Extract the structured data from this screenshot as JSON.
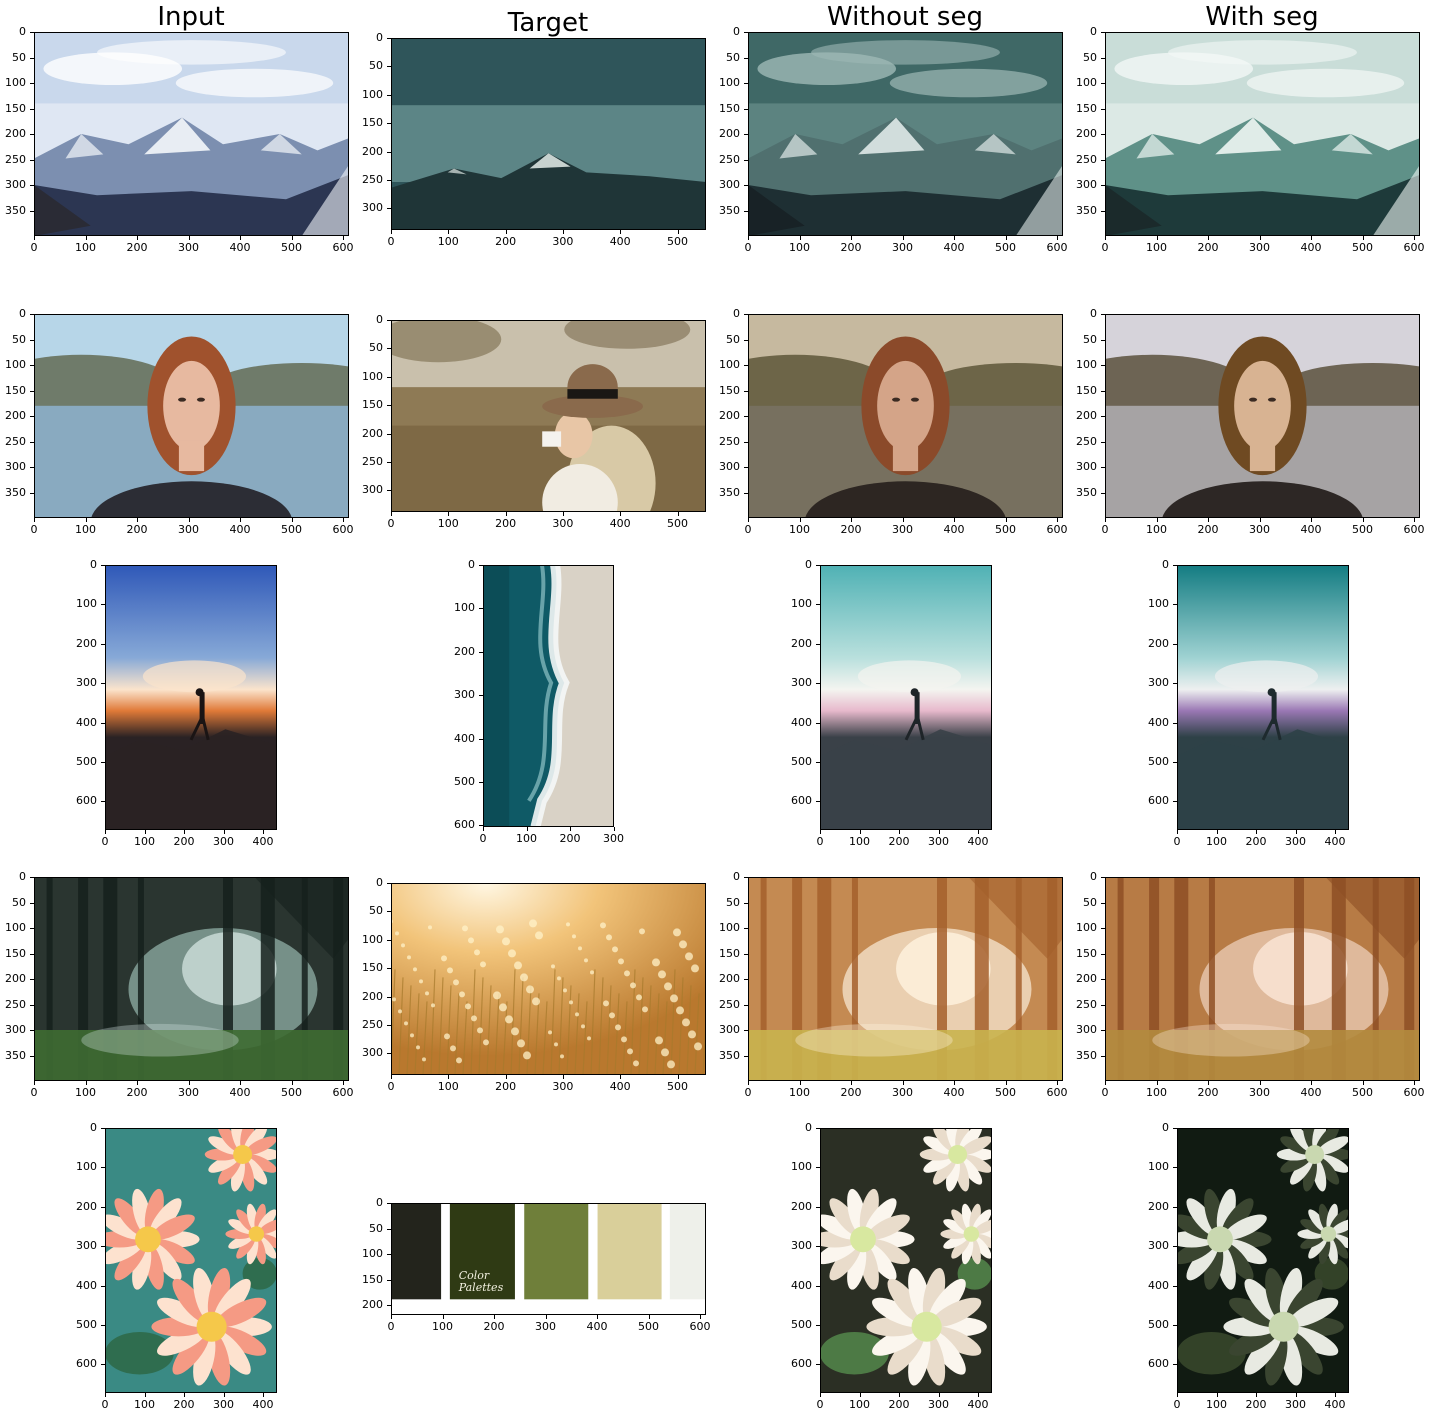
{
  "columns": [
    {
      "key": "input",
      "title": "Input"
    },
    {
      "key": "target",
      "title": "Target"
    },
    {
      "key": "without_seg",
      "title": "Without seg"
    },
    {
      "key": "with_seg",
      "title": "With seg"
    }
  ],
  "rows": [
    {
      "scene": "mountains",
      "panels": {
        "input": {
          "subject": "snowy mountain range under cloudy blue sky",
          "y_ticks": [
            "0",
            "50",
            "100",
            "150",
            "200",
            "250",
            "300",
            "350"
          ],
          "x_ticks": [
            "0",
            "100",
            "200",
            "300",
            "400",
            "500",
            "600"
          ]
        },
        "target": {
          "subject": "teal dusk sky over dark mountain silhouette",
          "y_ticks": [
            "0",
            "50",
            "100",
            "150",
            "200",
            "250",
            "300"
          ],
          "x_ticks": [
            "0",
            "100",
            "200",
            "300",
            "400",
            "500"
          ]
        },
        "without_seg": {
          "subject": "mountain range recolored dark teal",
          "y_ticks": [
            "0",
            "50",
            "100",
            "150",
            "200",
            "250",
            "300",
            "350"
          ],
          "x_ticks": [
            "0",
            "100",
            "200",
            "300",
            "400",
            "500",
            "600"
          ]
        },
        "with_seg": {
          "subject": "mountain range recolored light teal",
          "y_ticks": [
            "0",
            "50",
            "100",
            "150",
            "200",
            "250",
            "300",
            "350"
          ],
          "x_ticks": [
            "0",
            "100",
            "200",
            "300",
            "400",
            "500",
            "600"
          ]
        }
      }
    },
    {
      "scene": "portrait",
      "panels": {
        "input": {
          "subject": "red-haired woman portrait by a lake",
          "y_ticks": [
            "0",
            "50",
            "100",
            "150",
            "200",
            "250",
            "300",
            "350"
          ],
          "x_ticks": [
            "0",
            "100",
            "200",
            "300",
            "400",
            "500",
            "600"
          ]
        },
        "target": {
          "subject": "woman in hat drinking from cup in autumn field",
          "y_ticks": [
            "0",
            "50",
            "100",
            "150",
            "200",
            "250",
            "300"
          ],
          "x_ticks": [
            "0",
            "100",
            "200",
            "300",
            "400",
            "500"
          ]
        },
        "without_seg": {
          "subject": "portrait recolored warm brown",
          "y_ticks": [
            "0",
            "50",
            "100",
            "150",
            "200",
            "250",
            "300",
            "350"
          ],
          "x_ticks": [
            "0",
            "100",
            "200",
            "300",
            "400",
            "500",
            "600"
          ]
        },
        "with_seg": {
          "subject": "portrait recolored muted grey-brown",
          "y_ticks": [
            "0",
            "50",
            "100",
            "150",
            "200",
            "250",
            "300",
            "350"
          ],
          "x_ticks": [
            "0",
            "100",
            "200",
            "300",
            "400",
            "500",
            "600"
          ]
        }
      }
    },
    {
      "scene": "sunset silhouette",
      "panels": {
        "input": {
          "subject": "person silhouette walking at sunset",
          "y_ticks": [
            "0",
            "100",
            "200",
            "300",
            "400",
            "500",
            "600"
          ],
          "x_ticks": [
            "0",
            "100",
            "200",
            "300",
            "400"
          ]
        },
        "target": {
          "subject": "aerial view of teal ocean waves on sand",
          "y_ticks": [
            "0",
            "100",
            "200",
            "300",
            "400",
            "500",
            "600"
          ],
          "x_ticks": [
            "0",
            "100",
            "200",
            "300"
          ]
        },
        "without_seg": {
          "subject": "silhouette recolored teal and pink",
          "y_ticks": [
            "0",
            "100",
            "200",
            "300",
            "400",
            "500",
            "600"
          ],
          "x_ticks": [
            "0",
            "100",
            "200",
            "300",
            "400"
          ]
        },
        "with_seg": {
          "subject": "silhouette recolored deep teal and violet",
          "y_ticks": [
            "0",
            "100",
            "200",
            "300",
            "400",
            "500",
            "600"
          ],
          "x_ticks": [
            "0",
            "100",
            "200",
            "300",
            "400"
          ]
        }
      }
    },
    {
      "scene": "forest",
      "panels": {
        "input": {
          "subject": "dark misty green forest",
          "y_ticks": [
            "0",
            "50",
            "100",
            "150",
            "200",
            "250",
            "300",
            "350"
          ],
          "x_ticks": [
            "0",
            "100",
            "200",
            "300",
            "400",
            "500",
            "600"
          ]
        },
        "target": {
          "subject": "golden backlit meadow grass",
          "y_ticks": [
            "0",
            "50",
            "100",
            "150",
            "200",
            "250",
            "300"
          ],
          "x_ticks": [
            "0",
            "100",
            "200",
            "300",
            "400",
            "500"
          ]
        },
        "without_seg": {
          "subject": "forest recolored warm orange haze",
          "y_ticks": [
            "0",
            "50",
            "100",
            "150",
            "200",
            "250",
            "300",
            "350"
          ],
          "x_ticks": [
            "0",
            "100",
            "200",
            "300",
            "400",
            "500",
            "600"
          ]
        },
        "with_seg": {
          "subject": "forest recolored orange-brown",
          "y_ticks": [
            "0",
            "50",
            "100",
            "150",
            "200",
            "250",
            "300",
            "350"
          ],
          "x_ticks": [
            "0",
            "100",
            "200",
            "300",
            "400",
            "500",
            "600"
          ]
        }
      }
    },
    {
      "scene": "dahlias",
      "panels": {
        "input": {
          "subject": "pink and peach dahlia flowers",
          "y_ticks": [
            "0",
            "100",
            "200",
            "300",
            "400",
            "500",
            "600"
          ],
          "x_ticks": [
            "0",
            "100",
            "200",
            "300",
            "400"
          ]
        },
        "target": {
          "subject": "olive and cream color palette swatches",
          "y_ticks": [
            "0",
            "50",
            "100",
            "150",
            "200"
          ],
          "x_ticks": [
            "0",
            "100",
            "200",
            "300",
            "400",
            "500",
            "600"
          ],
          "overlay_text": [
            "Color",
            "Palettes"
          ],
          "swatches": [
            "#23241c",
            "#2f3a14",
            "#6f7f3a",
            "#d9cf9a",
            "#eef0ea"
          ]
        },
        "without_seg": {
          "subject": "dahlias recolored cream and lime green",
          "y_ticks": [
            "0",
            "100",
            "200",
            "300",
            "400",
            "500",
            "600"
          ],
          "x_ticks": [
            "0",
            "100",
            "200",
            "300",
            "400"
          ]
        },
        "with_seg": {
          "subject": "dahlias recolored white and dark olive",
          "y_ticks": [
            "0",
            "100",
            "200",
            "300",
            "400",
            "500",
            "600"
          ],
          "x_ticks": [
            "0",
            "100",
            "200",
            "300",
            "400"
          ]
        }
      }
    }
  ]
}
